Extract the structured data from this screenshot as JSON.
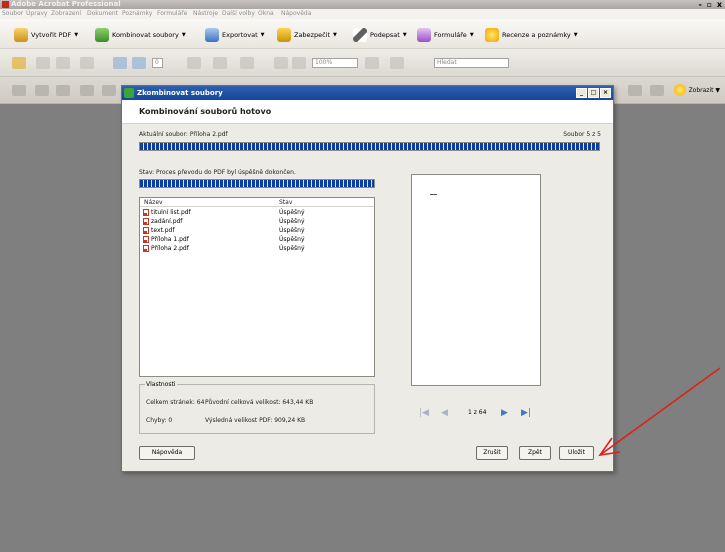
{
  "window": {
    "title": "Adobe Acrobat Professional",
    "controls": "-  ▫ x"
  },
  "menu": [
    "Soubor",
    "Úpravy",
    "Zobrazení",
    "Dokument",
    "Poznámky",
    "Formuláře",
    "Nástroje",
    "Další volby",
    "Okna",
    "Nápověda"
  ],
  "toolbar": {
    "create_pdf": "Vytvořit PDF",
    "combine": "Kombinovat soubory",
    "export": "Exportovat",
    "secure": "Zabezpečit",
    "sign": "Podepsat",
    "forms": "Formuláře",
    "review": "Recenze a poznámky",
    "page_number": "0",
    "page_total": "/0",
    "zoom": "100%",
    "search_placeholder": "Hledat",
    "show": "Zobrazit"
  },
  "icons": {
    "create_pdf": "pdf-create-icon",
    "combine": "combine-files-icon",
    "export": "export-icon",
    "secure": "lock-icon",
    "sign": "pen-icon",
    "forms": "form-icon",
    "review": "speech-bubble-icon",
    "show": "speech-bubble-icon"
  },
  "dialog": {
    "title": "Zkombinovat soubory",
    "heading": "Kombinování souborů hotovo",
    "current_file_label": "Aktuální soubor: Příloha 2.pdf",
    "file_counter": "Soubor 5 z 5",
    "status": "Stav: Proces převodu do PDF byl úspěšně dokončen.",
    "overall_progress": 1.0,
    "conversion_progress": 1.0,
    "columns": [
      "Název",
      "Stav"
    ],
    "files": [
      {
        "name": "titulní list.pdf",
        "status": "Úspěšný"
      },
      {
        "name": "zadání.pdf",
        "status": "Úspěšný"
      },
      {
        "name": "text.pdf",
        "status": "Úspěšný"
      },
      {
        "name": "Příloha 1.pdf",
        "status": "Úspěšný"
      },
      {
        "name": "Příloha 2.pdf",
        "status": "Úspěšný"
      }
    ],
    "properties": {
      "legend": "Vlastnosti",
      "total_pages": "Celkem stránek: 64",
      "errors": "Chyby: 0",
      "original_size": "Původní celková velikost: 643,44 KB",
      "result_size": "Výsledná velikost PDF: 909,24 KB"
    },
    "pager": {
      "counter": "1 z 64"
    },
    "buttons": {
      "help": "Nápověda",
      "cancel": "Zrušit",
      "back": "Zpět",
      "save": "Uložit"
    }
  },
  "colors": {
    "progress": "#0c3ea0",
    "dialog_title": "#13479b",
    "annotation_arrow": "#e0201c"
  }
}
